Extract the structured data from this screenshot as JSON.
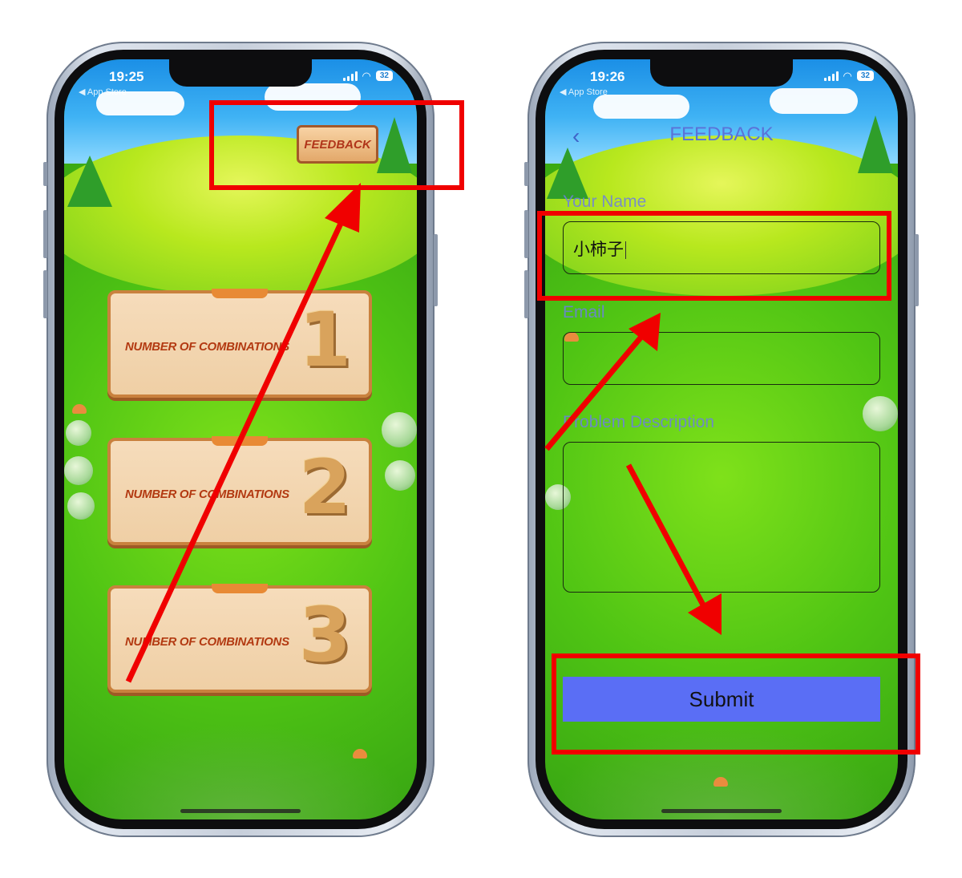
{
  "left_phone": {
    "status": {
      "time": "19:25",
      "back_label": "◀ App Store",
      "battery": "32"
    },
    "feedback_label": "FEEDBACK",
    "levels": [
      {
        "label": "NUMBER OF COMBINATIONS",
        "digit": "1"
      },
      {
        "label": "NUMBER OF COMBINATIONS",
        "digit": "2"
      },
      {
        "label": "NUMBER OF COMBINATIONS",
        "digit": "3"
      }
    ]
  },
  "right_phone": {
    "status": {
      "time": "19:26",
      "back_label": "◀ App Store",
      "battery": "32"
    },
    "title": "FEEDBACK",
    "back_icon": "‹",
    "name_label": "Your Name",
    "name_value": "小柿子",
    "email_label": "Email",
    "email_value": "",
    "problem_label": "Problem Description",
    "problem_value": "",
    "submit_label": "Submit"
  },
  "colors": {
    "annotation_red": "#f00000",
    "submit_blue": "#5a6ef5",
    "title_blue": "#5a72d8"
  }
}
